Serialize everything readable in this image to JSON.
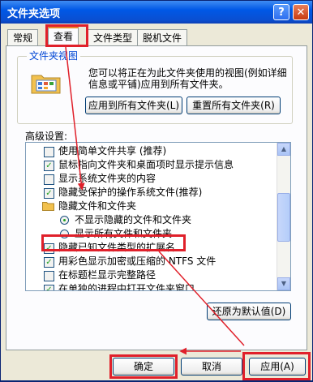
{
  "window": {
    "title": "文件夹选项",
    "help_glyph": "?",
    "close_glyph": "✕"
  },
  "tabs": [
    {
      "label": "常规"
    },
    {
      "label": "查看"
    },
    {
      "label": "文件类型"
    },
    {
      "label": "脱机文件"
    }
  ],
  "folder_views": {
    "group_label": "文件夹视图",
    "description": "您可以将正在为此文件夹使用的视图(例如详细信息或平铺)应用到所有文件夹。",
    "apply_all_label": "应用到所有文件夹(L)",
    "reset_all_label": "重置所有文件夹(R)",
    "icon": "folder-view-icon"
  },
  "advanced": {
    "label": "高级设置:",
    "items": [
      {
        "type": "checkbox",
        "checked": false,
        "label": "使用简单文件共享 (推荐)"
      },
      {
        "type": "checkbox",
        "checked": true,
        "label": "鼠标指向文件夹和桌面项时显示提示信息"
      },
      {
        "type": "checkbox",
        "checked": false,
        "label": "显示系统文件夹的内容"
      },
      {
        "type": "checkbox",
        "checked": true,
        "label": "隐藏受保护的操作系统文件(推荐)"
      },
      {
        "type": "folder",
        "label": "隐藏文件和文件夹"
      },
      {
        "type": "radio",
        "selected": true,
        "label": "不显示隐藏的文件和文件夹"
      },
      {
        "type": "radio",
        "selected": false,
        "label": "显示所有文件和文件夹"
      },
      {
        "type": "checkbox",
        "checked": true,
        "label": "隐藏已知文件类型的扩展名"
      },
      {
        "type": "checkbox",
        "checked": true,
        "label": "用彩色显示加密或压缩的 NTFS 文件"
      },
      {
        "type": "checkbox",
        "checked": false,
        "label": "在标题栏显示完整路径"
      },
      {
        "type": "checkbox",
        "checked": true,
        "label": "在单独的进程中打开文件夹窗口"
      }
    ],
    "restore_defaults_label": "还原为默认值(D)"
  },
  "footer": {
    "ok_label": "确定",
    "cancel_label": "取消",
    "apply_label": "应用(A)"
  },
  "colors": {
    "title_bar": "#0058e6",
    "highlight_box": "#e0202a",
    "arrow": "#e0202a",
    "active_tab_accent": "#e68b2c"
  }
}
